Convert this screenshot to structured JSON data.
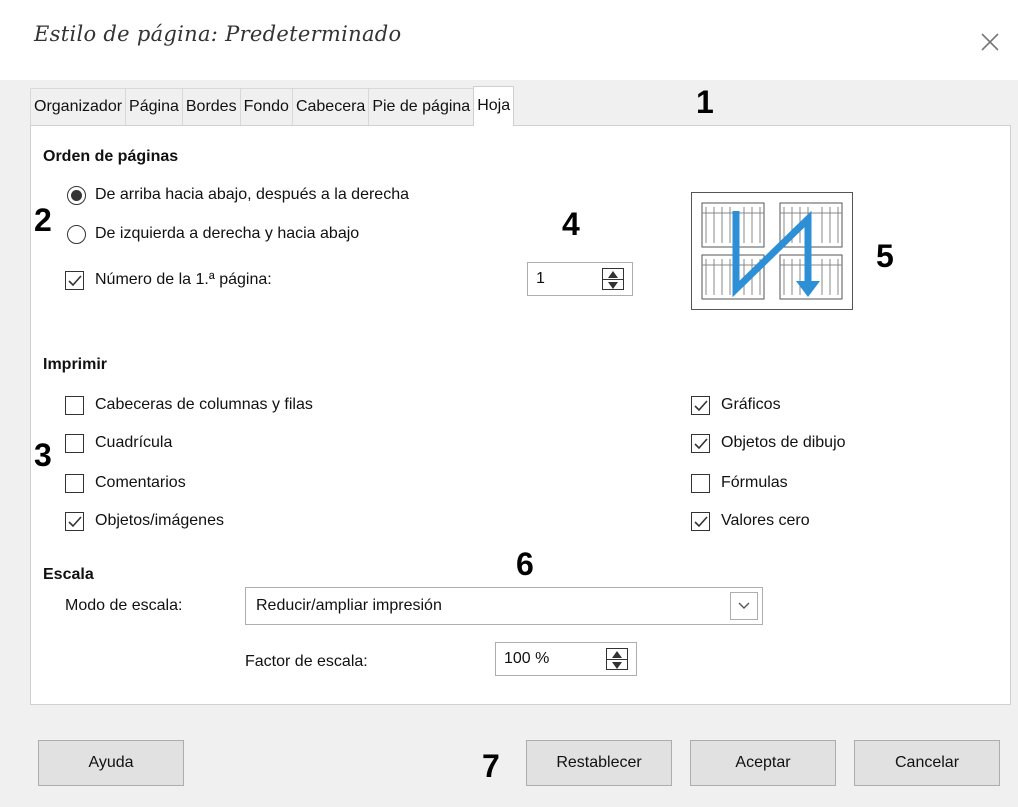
{
  "window": {
    "title": "Estilo de página: Predeterminado"
  },
  "tabs": [
    {
      "label": "Organizador"
    },
    {
      "label": "Página"
    },
    {
      "label": "Bordes"
    },
    {
      "label": "Fondo"
    },
    {
      "label": "Cabecera"
    },
    {
      "label": "Pie de página"
    },
    {
      "label": "Hoja",
      "active": true
    }
  ],
  "page_order": {
    "heading": "Orden de páginas",
    "option_top_down": "De arriba hacia abajo, después a la derecha",
    "option_left_right": "De izquierda a derecha y hacia abajo",
    "selected": "top_down",
    "first_page_label": "Número de la 1.ª página:",
    "first_page_checked": true,
    "first_page_value": "1",
    "preview_icon": "page-order-preview-icon"
  },
  "print": {
    "heading": "Imprimir",
    "left": [
      {
        "label": "Cabeceras de columnas y filas",
        "checked": false
      },
      {
        "label": "Cuadrícula",
        "checked": false
      },
      {
        "label": "Comentarios",
        "checked": false
      },
      {
        "label": "Objetos/imágenes",
        "checked": true
      }
    ],
    "right": [
      {
        "label": "Gráficos",
        "checked": true
      },
      {
        "label": "Objetos de dibujo",
        "checked": true
      },
      {
        "label": "Fórmulas",
        "checked": false
      },
      {
        "label": "Valores cero",
        "checked": true
      }
    ]
  },
  "scale": {
    "heading": "Escala",
    "mode_label": "Modo de escala:",
    "mode_value": "Reducir/ampliar impresión",
    "factor_label": "Factor de escala:",
    "factor_value": "100 %"
  },
  "buttons": {
    "help": "Ayuda",
    "reset": "Restablecer",
    "ok": "Aceptar",
    "cancel": "Cancelar"
  },
  "annotations": [
    "1",
    "2",
    "3",
    "4",
    "5",
    "6",
    "7"
  ],
  "colors": {
    "arrow": "#2d8fd5",
    "panel_bg": "#ffffff",
    "dialog_bg": "#f0f0f0"
  }
}
